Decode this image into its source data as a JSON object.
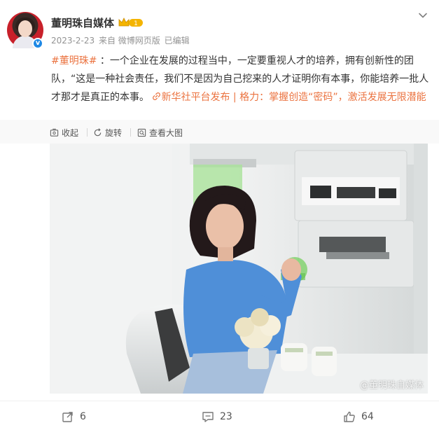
{
  "author": {
    "name": "董明珠自媒体",
    "badge_level": "1"
  },
  "meta": {
    "date": "2023-2-23",
    "source": "来自 微博网页版",
    "edited": "已编辑"
  },
  "post": {
    "topic": "#董明珠#",
    "body": "：一个企业在发展的过程当中，一定要重视人才的培养，拥有创新性的团队，“这是一种社会责任，我们不是因为自己挖来的人才证明你有本事，你能培养一批人才那才是真正的本事。",
    "link_text": "新华社平台发布 | 格力：掌握创造“密码”，激活发展无限潜能"
  },
  "image_toolbar": {
    "collapse_label": "收起",
    "rotate_label": "旋转",
    "view_large_label": "查看大图"
  },
  "image": {
    "watermark": "@董明珠自媒体"
  },
  "actions": {
    "repost_count": "6",
    "comment_count": "23",
    "like_count": "64"
  },
  "colors": {
    "accent": "#eb7340",
    "verify_blue": "#1e88e5",
    "meta_gray": "#939393"
  },
  "icons": [
    "crown-badge-icon",
    "chevron-down-icon",
    "collapse-icon",
    "rotate-icon",
    "zoom-icon",
    "link-icon",
    "repost-icon",
    "comment-icon",
    "like-icon"
  ]
}
